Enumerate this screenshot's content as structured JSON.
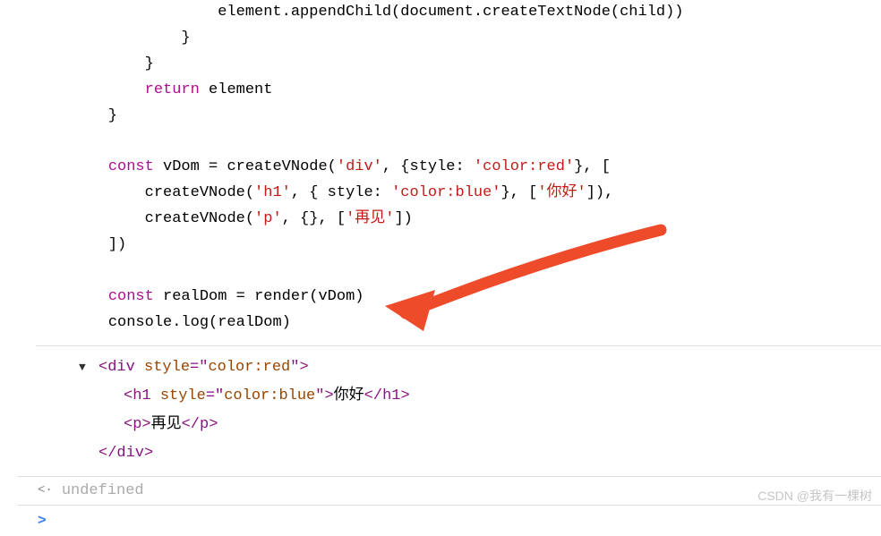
{
  "code": {
    "line1_indent": "                element.appendChild(document.createTextNode(child))",
    "line2_indent": "            }",
    "line3_indent": "        }",
    "return_kw": "return",
    "return_var": " element",
    "return_indent": "        ",
    "close_brace": "    }",
    "empty": "",
    "const_kw": "const",
    "vdom_var": " vDom ",
    "eq": "= ",
    "createVNode": "createVNode",
    "div_str": "'div'",
    "style_key": "style: ",
    "color_red": "'color:red'",
    "h1_str": "'h1'",
    "color_blue": "'color:blue'",
    "nihao": "'你好'",
    "p_str": "'p'",
    "zaijian": "'再见'",
    "realdom_var": " realDom ",
    "render": "render",
    "vdom_arg": "vDom",
    "console_log": "console.log",
    "realdom_arg": "realDom",
    "indent4": "    ",
    "indent8": "        "
  },
  "output": {
    "div_open_tag": "<div ",
    "style_attr": "style",
    "eq_quote": "=\"",
    "color_red_val": "color:red",
    "close_quote_bracket": "\">",
    "h1_open_tag": "<h1 ",
    "color_blue_val": "color:blue",
    "nihao_text": "你好",
    "h1_close": "</h1>",
    "p_open": "<p>",
    "zaijian_text": "再见",
    "p_close": "</p>",
    "div_close": "</div>"
  },
  "return_value": "undefined",
  "watermark": "CSDN @我有一棵树"
}
